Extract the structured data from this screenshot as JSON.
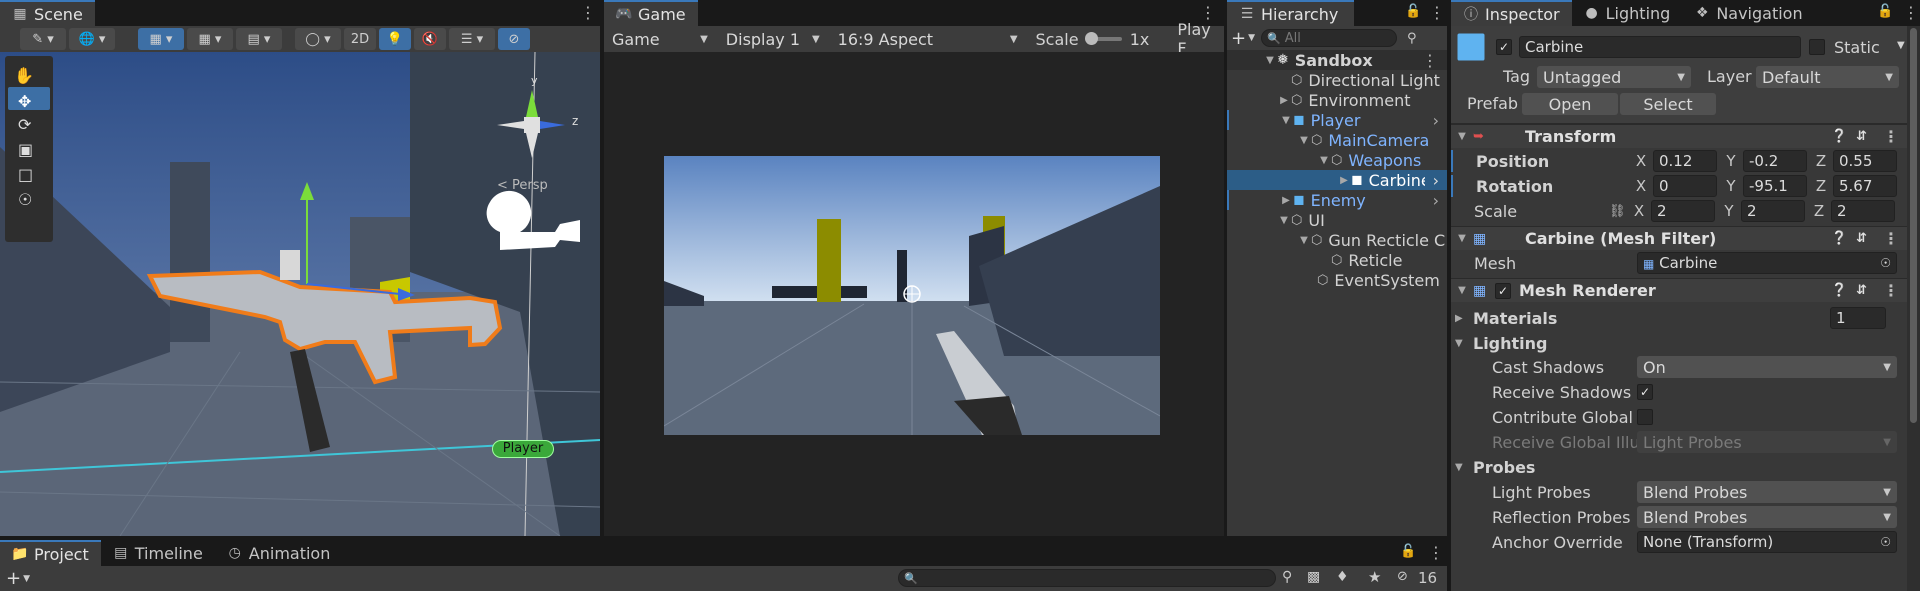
{
  "scene": {
    "tab": "Scene",
    "btn_2d": "2D",
    "gizmo": {
      "y": "y",
      "z": "z",
      "persp": "< Persp"
    },
    "player_label": "Player"
  },
  "game": {
    "tab": "Game",
    "mode": "Game",
    "display": "Display 1",
    "aspect": "16:9 Aspect",
    "scale_label": "Scale",
    "scale_value": "1x",
    "play_label": "Play F"
  },
  "hierarchy": {
    "tab": "Hierarchy",
    "search_placeholder": "All",
    "root": "Sandbox",
    "items": [
      {
        "label": "Directional Light"
      },
      {
        "label": "Environment"
      },
      {
        "label": "Player"
      },
      {
        "label": "MainCamera"
      },
      {
        "label": "Weapons"
      },
      {
        "label": "Carbine"
      },
      {
        "label": "Enemy"
      },
      {
        "label": "UI"
      },
      {
        "label": "Gun Recticle C"
      },
      {
        "label": "Reticle"
      },
      {
        "label": "EventSystem"
      }
    ]
  },
  "inspector": {
    "tabs": {
      "inspector": "Inspector",
      "lighting": "Lighting",
      "navigation": "Navigation"
    },
    "object_name": "Carbine",
    "static_label": "Static",
    "tag_label": "Tag",
    "tag_value": "Untagged",
    "layer_label": "Layer",
    "layer_value": "Default",
    "prefab_label": "Prefab",
    "open_label": "Open",
    "select_label": "Select",
    "transform": {
      "title": "Transform",
      "position_label": "Position",
      "rotation_label": "Rotation",
      "scale_label": "Scale",
      "x": "X",
      "y": "Y",
      "z": "Z",
      "position": {
        "x": "0.12",
        "y": "-0.2",
        "z": "0.55"
      },
      "rotation": {
        "x": "0",
        "y": "-95.1",
        "z": "5.67"
      },
      "scale": {
        "x": "2",
        "y": "2",
        "z": "2"
      }
    },
    "mesh_filter": {
      "title": "Carbine (Mesh Filter)",
      "mesh_label": "Mesh",
      "mesh_value": "Carbine"
    },
    "mesh_renderer": {
      "title": "Mesh Renderer",
      "materials_label": "Materials",
      "materials_count": "1",
      "lighting_label": "Lighting",
      "cast_shadows_label": "Cast Shadows",
      "cast_shadows_value": "On",
      "receive_shadows_label": "Receive Shadows",
      "contribute_gi_label": "Contribute Global Ill",
      "receive_gi_label": "Receive Global Illun",
      "receive_gi_value": "Light Probes",
      "probes_label": "Probes",
      "light_probes_label": "Light Probes",
      "light_probes_value": "Blend Probes",
      "reflection_probes_label": "Reflection Probes",
      "reflection_probes_value": "Blend Probes",
      "anchor_override_label": "Anchor Override",
      "anchor_override_value": "None (Transform)"
    }
  },
  "bottom": {
    "tabs": {
      "project": "Project",
      "timeline": "Timeline",
      "animation": "Animation"
    },
    "hidden_count": "16"
  },
  "colors": {
    "selection": "#2c5d87",
    "accent_blue": "#3a79bb",
    "prefab_blue": "#7fb4ff",
    "player_badge": "#3aa83a"
  }
}
